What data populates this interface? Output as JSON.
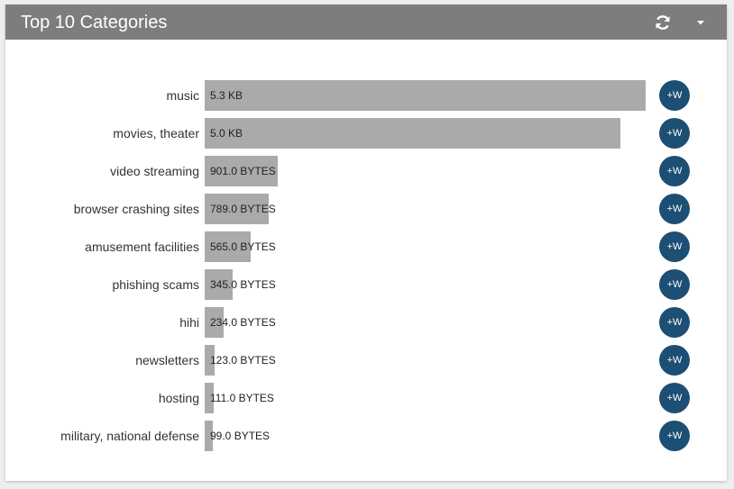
{
  "panel": {
    "title": "Top 10 Categories",
    "refresh_icon": "refresh-icon",
    "menu_icon": "caret-down-icon",
    "header_color": "#7d7d7d",
    "bar_color": "#aaaaaa",
    "button_color": "#1d4e74",
    "watch_label": "+W"
  },
  "chart_data": {
    "type": "bar",
    "orientation": "horizontal",
    "title": "Top 10 Categories",
    "categories": [
      "music",
      "movies, theater",
      "video streaming",
      "browser crashing sites",
      "amusement facilities",
      "phishing scams",
      "hihi",
      "newsletters",
      "hosting",
      "military, national defense"
    ],
    "value_labels": [
      "5.3 KB",
      "5.0 KB",
      "901.0 BYTES",
      "789.0 BYTES",
      "565.0 BYTES",
      "345.0 BYTES",
      "234.0 BYTES",
      "123.0 BYTES",
      "111.0 BYTES",
      "99.0 BYTES"
    ],
    "values_bytes": [
      5427,
      5120,
      901,
      789,
      565,
      345,
      234,
      123,
      111,
      99
    ],
    "grid": false
  }
}
